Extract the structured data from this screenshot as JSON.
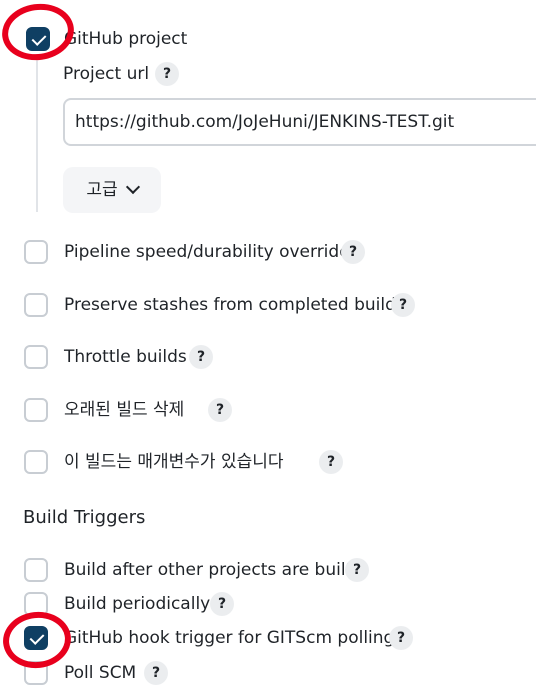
{
  "github_project": {
    "label": "GitHub project",
    "checked": true,
    "project_url_label": "Project url",
    "project_url_value": "https://github.com/JoJeHuni/JENKINS-TEST.git",
    "advanced_label": "고급"
  },
  "options": [
    {
      "label": "Pipeline speed/durability override",
      "checked": false
    },
    {
      "label": "Preserve stashes from completed builds",
      "checked": false
    },
    {
      "label": "Throttle builds",
      "checked": false
    },
    {
      "label": "오래된 빌드 삭제",
      "checked": false
    },
    {
      "label": "이 빌드는 매개변수가 있습니다",
      "checked": false
    }
  ],
  "build_triggers": {
    "title": "Build Triggers",
    "items": [
      {
        "label": "Build after other projects are built",
        "checked": false
      },
      {
        "label": "Build periodically",
        "checked": false
      },
      {
        "label": "GitHub hook trigger for GITScm polling",
        "checked": true
      },
      {
        "label": "Poll SCM",
        "checked": false
      }
    ]
  },
  "help_text": "?",
  "colors": {
    "accent": "#0f3f63",
    "annotation": "#e8001d"
  }
}
